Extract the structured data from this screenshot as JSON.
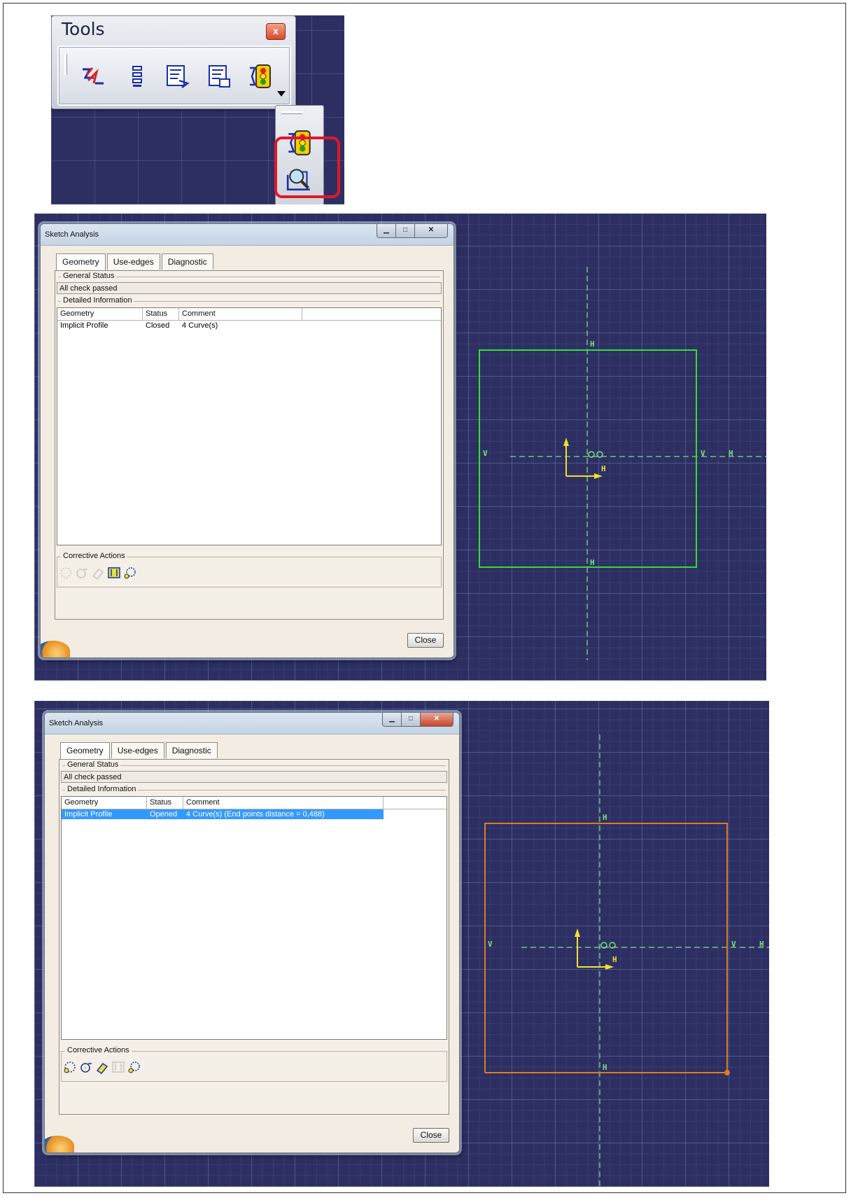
{
  "tools": {
    "title": "Tools",
    "close_symbol": "x",
    "buttons": [
      "constraint-icon",
      "list-icon",
      "update-icon",
      "update-all-icon",
      "sketch-solving-status-icon"
    ],
    "flyout_buttons": [
      "sketch-solving-status-icon",
      "sketch-analysis-icon"
    ],
    "highlight_color": "#e0182a"
  },
  "panel1": {
    "title": "Sketch Analysis",
    "tabs": [
      "Geometry",
      "Use-edges",
      "Diagnostic"
    ],
    "general_status_label": "General Status",
    "general_status_value": "All check passed",
    "detailed_info_label": "Detailed Information",
    "columns": [
      "Geometry",
      "Status",
      "Comment"
    ],
    "rows": [
      {
        "geometry": "Implicit Profile",
        "status": "Closed",
        "comment": "4 Curve(s)"
      }
    ],
    "corrective_actions_label": "Corrective Actions",
    "close_label": "Close",
    "profile_color": "#33dd33",
    "labels": {
      "h_top": "H",
      "h_bottom": "H",
      "v_left": "V",
      "v_right": "V",
      "h_right": "H",
      "axis_h": "H",
      "axis_v": "V"
    }
  },
  "panel2": {
    "title": "Sketch Analysis",
    "tabs": [
      "Geometry",
      "Use-edges",
      "Diagnostic"
    ],
    "general_status_label": "General Status",
    "general_status_value": "All check passed",
    "detailed_info_label": "Detailed Information",
    "columns": [
      "Geometry",
      "Status",
      "Comment"
    ],
    "rows": [
      {
        "geometry": "Implicit Profile",
        "status": "Opened",
        "comment": "4 Curve(s) (End points distance = 0,488)"
      }
    ],
    "corrective_actions_label": "Corrective Actions",
    "close_label": "Close",
    "profile_color": "#e07a22",
    "labels": {
      "h_top": "H",
      "h_bottom": "H",
      "v_left": "V",
      "v_right": "V",
      "h_right": "H",
      "axis_h": "H",
      "axis_v": "V"
    }
  }
}
